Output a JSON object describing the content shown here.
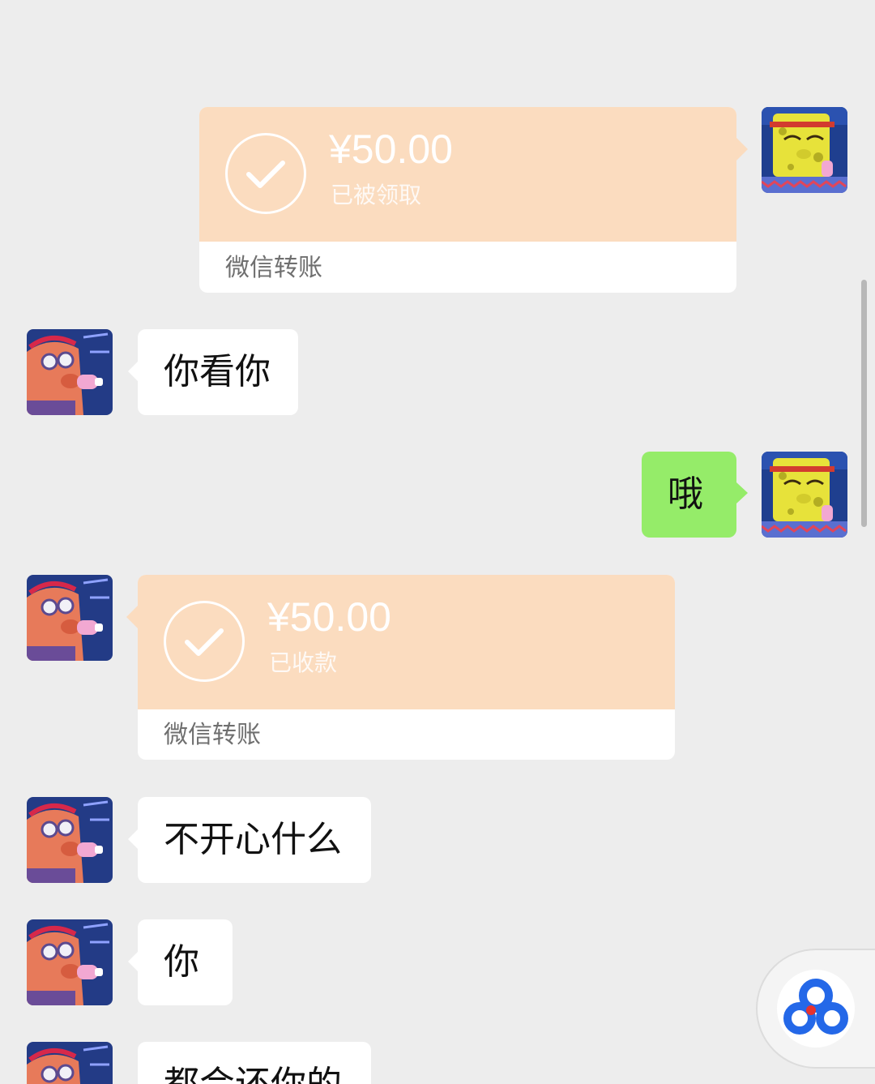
{
  "messages": {
    "m1": {
      "type": "transfer",
      "side": "right",
      "amount": "¥50.00",
      "status": "已被领取",
      "label": "微信转账"
    },
    "m2": {
      "type": "text",
      "side": "left",
      "text": "你看你"
    },
    "m3": {
      "type": "text",
      "side": "right",
      "text": "哦"
    },
    "m4": {
      "type": "transfer",
      "side": "left",
      "amount": "¥50.00",
      "status": "已收款",
      "label": "微信转账"
    },
    "m5": {
      "type": "text",
      "side": "left",
      "text": "不开心什么"
    },
    "m6": {
      "type": "text",
      "side": "left",
      "text": "你"
    },
    "m7": {
      "type": "text",
      "side": "left",
      "text": "都会还你的"
    }
  },
  "colors": {
    "background": "#ededed",
    "transfer_card": "#fbdcbf",
    "my_bubble": "#95ec69",
    "their_bubble": "#ffffff",
    "float_button_blue": "#2468e8",
    "float_button_red": "#e8322d"
  },
  "icons": {
    "transfer_status": "check-circle-icon",
    "floating_app": "cloud-app-icon",
    "my_avatar": "spongebob-avatar",
    "their_avatar": "patrick-avatar"
  }
}
